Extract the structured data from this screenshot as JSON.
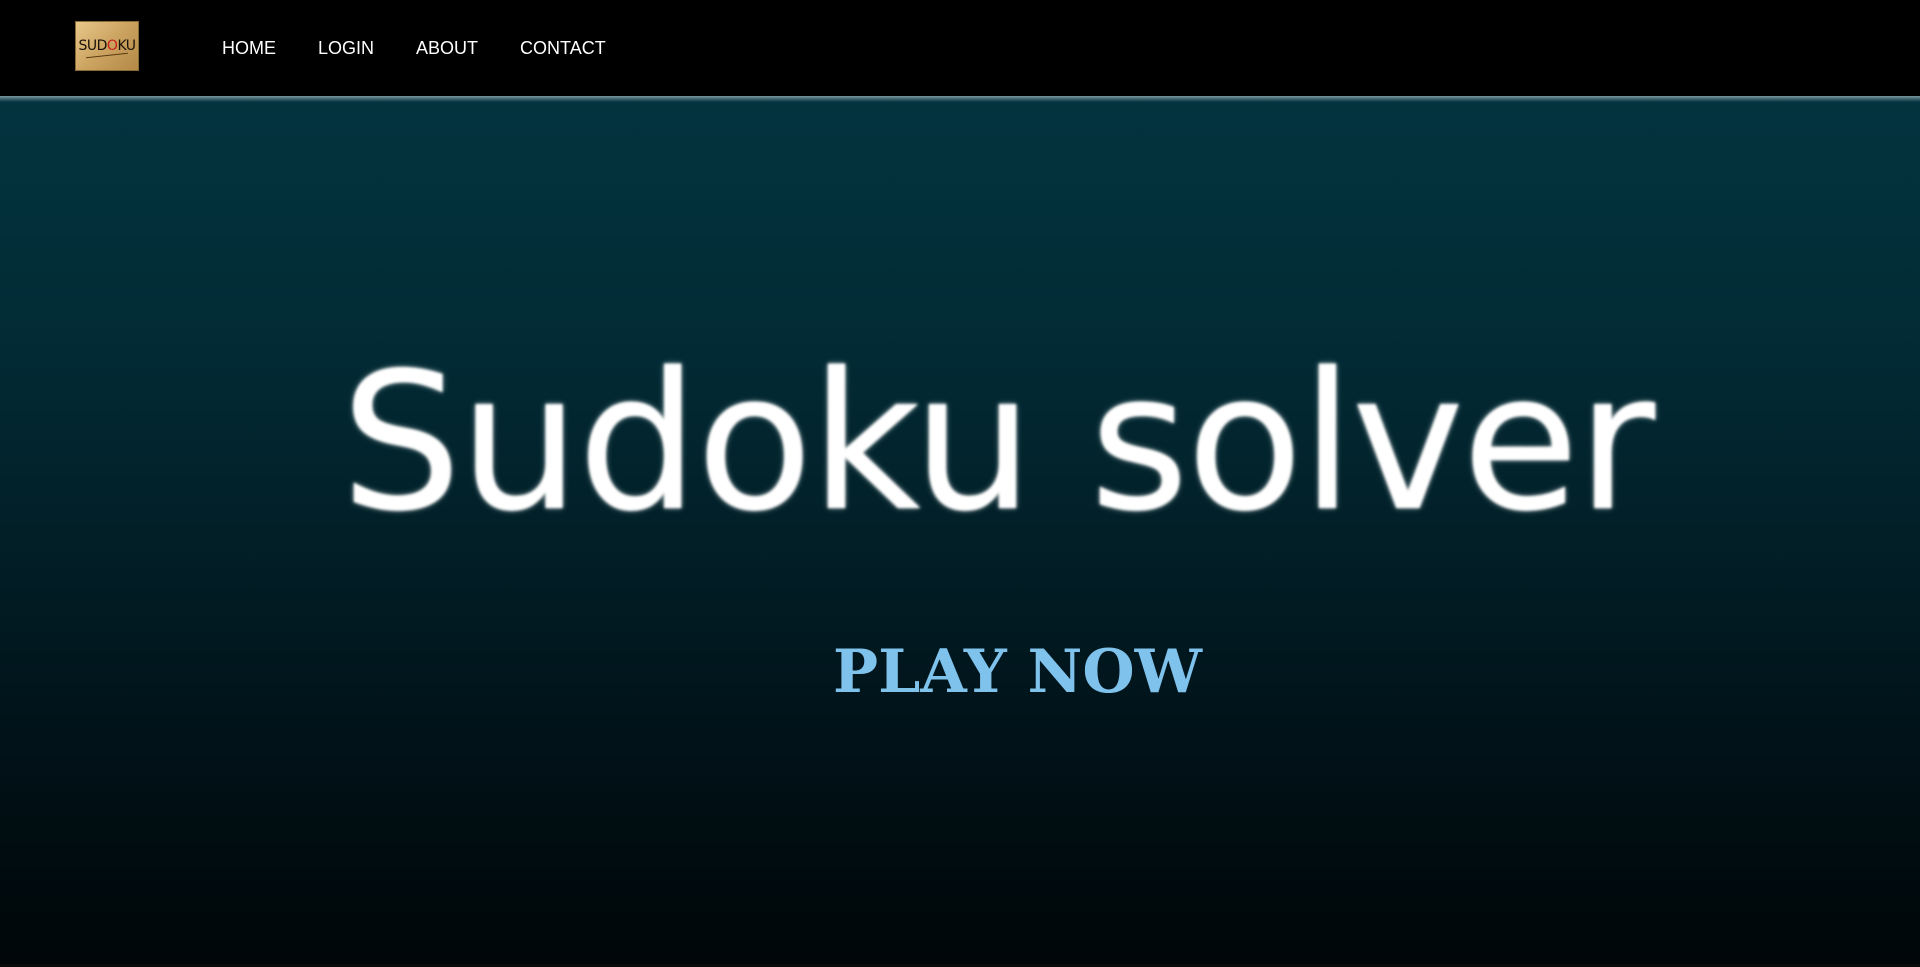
{
  "logo": {
    "text_prefix": "SUD",
    "text_o": "O",
    "text_suffix": "KU"
  },
  "nav": {
    "items": [
      {
        "label": "HOME"
      },
      {
        "label": "LOGIN"
      },
      {
        "label": "ABOUT"
      },
      {
        "label": "CONTACT"
      }
    ]
  },
  "hero": {
    "title": "Sudoku solver",
    "cta_label": "PLAY NOW"
  },
  "colors": {
    "nav_bg": "#000000",
    "hero_top": "#03343f",
    "hero_bottom": "#000608",
    "cta": "#7fc2ec"
  }
}
